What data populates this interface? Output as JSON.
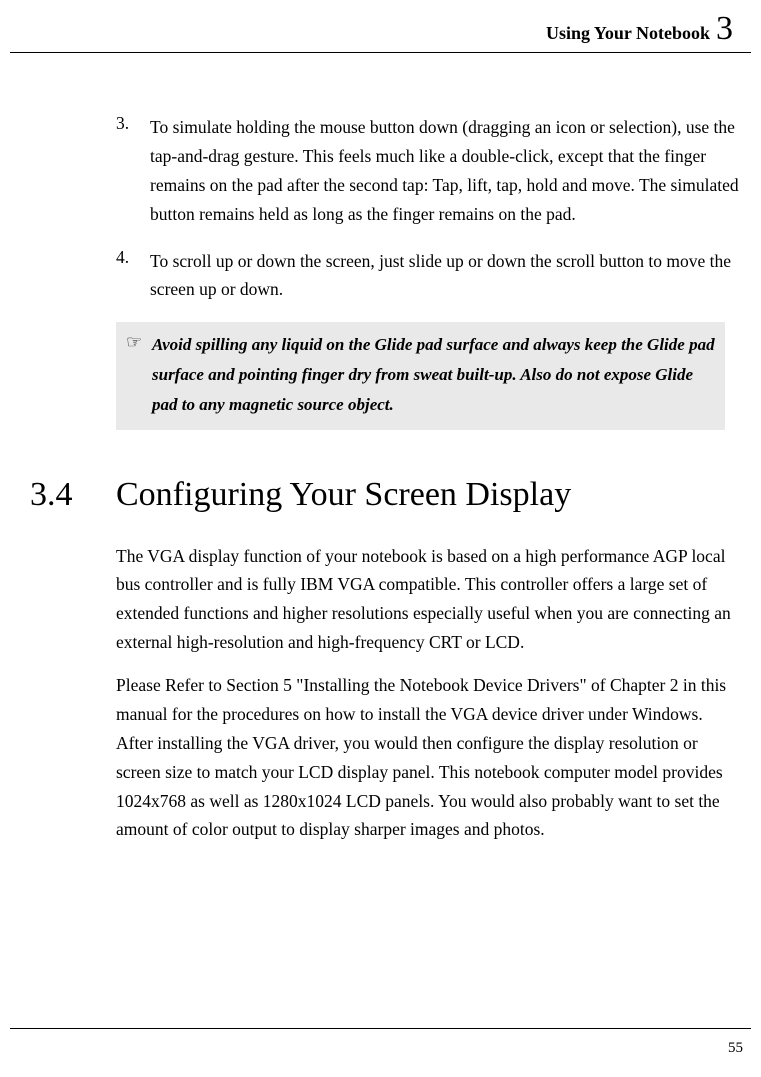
{
  "header": {
    "text": "Using Your Notebook",
    "chapter_number": "3"
  },
  "list_items": [
    {
      "num": "3.",
      "text": "To simulate holding the mouse button down (dragging an icon or selection), use the tap-and-drag gesture. This feels much like a double-click, except that the finger remains on the pad after the second tap: Tap, lift, tap, hold and move. The simulated button remains held as long as the finger remains on the pad."
    },
    {
      "num": "4.",
      "text": "To scroll up or down the screen, just slide up or down the scroll button to move the screen up or down."
    }
  ],
  "note": {
    "icon": "☞",
    "text": "Avoid spilling any liquid on the Glide pad surface and always keep the Glide pad surface and pointing finger dry from sweat built-up. Also do not expose Glide pad to any magnetic source object."
  },
  "section": {
    "number": "3.4",
    "title": "Configuring Your Screen Display"
  },
  "paragraphs": [
    "The VGA display function of your notebook is based on a high performance AGP local bus controller and is fully IBM VGA compatible. This controller offers a large set of extended functions and higher resolutions especially useful when you are connecting an external high-resolution and high-frequency CRT or LCD.",
    "Please Refer to Section 5 \"Installing the Notebook Device Drivers\" of Chapter 2 in this manual for the procedures on how to install the VGA device driver under Windows. After installing the VGA driver, you would then configure the display resolution or screen size to match your LCD display panel. This notebook computer model provides 1024x768 as well as 1280x1024 LCD panels. You would also probably want to set the amount of color output to display sharper images and photos."
  ],
  "page_number": "55"
}
